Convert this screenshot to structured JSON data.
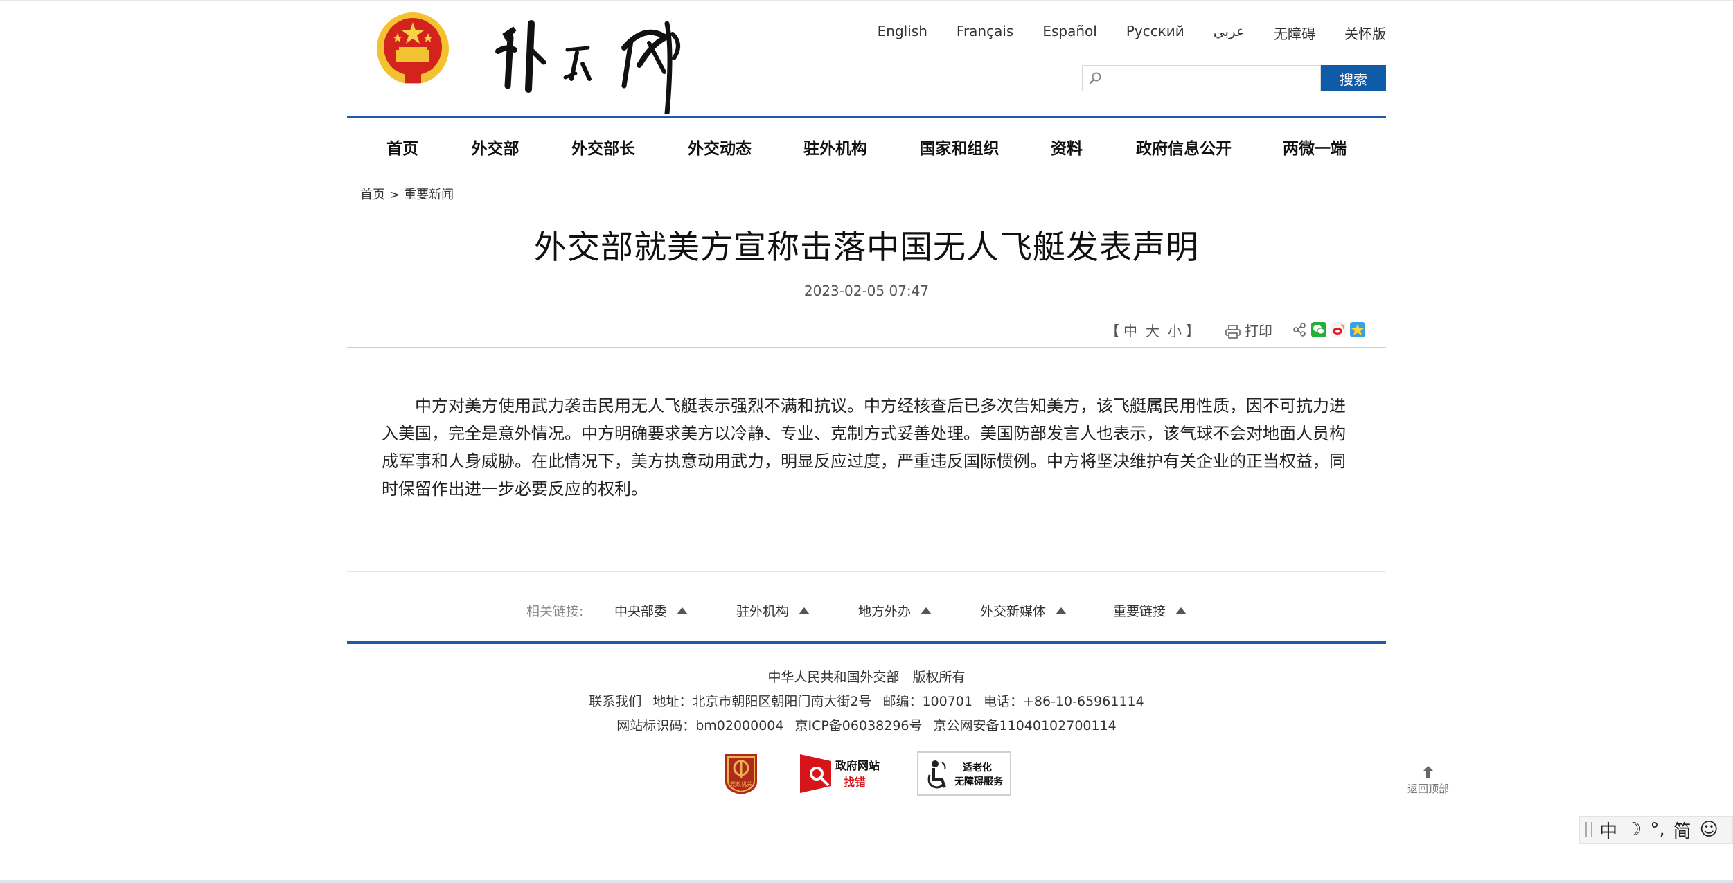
{
  "languages": [
    "English",
    "Français",
    "Español",
    "Русский",
    "عربي",
    "无障碍",
    "关怀版"
  ],
  "search": {
    "placeholder": "",
    "button_label": "搜索"
  },
  "nav": [
    "首页",
    "外交部",
    "外交部长",
    "外交动态",
    "驻外机构",
    "国家和组织",
    "资料",
    "政府信息公开",
    "两微一端"
  ],
  "breadcrumb": {
    "home": "首页",
    "sep": ">",
    "current": "重要新闻"
  },
  "article": {
    "title": "外交部就美方宣称击落中国无人飞艇发表声明",
    "date": "2023-02-05 07:47",
    "body": "中方对美方使用武力袭击民用无人飞艇表示强烈不满和抗议。中方经核查后已多次告知美方，该飞艇属民用性质，因不可抗力进入美国，完全是意外情况。中方明确要求美方以冷静、专业、克制方式妥善处理。美国防部发言人也表示，该气球不会对地面人员构成军事和人身威胁。在此情况下，美方执意动用武力，明显反应过度，严重违反国际惯例。中方将坚决维护有关企业的正当权益，同时保留作出进一步必要反应的权利。"
  },
  "tools": {
    "bracket_open": "【",
    "sizes": [
      "中",
      "大",
      "小"
    ],
    "bracket_close": "】",
    "print_label": "打印",
    "share_icons": [
      "share-icon",
      "wechat-icon",
      "weibo-icon",
      "qzone-icon"
    ]
  },
  "related": {
    "label": "相关链接:",
    "items": [
      "中央部委",
      "驻外机构",
      "地方外办",
      "外交新媒体",
      "重要链接"
    ]
  },
  "footer": {
    "line1": "中华人民共和国外交部　版权所有",
    "line2": [
      "联系我们",
      "地址：北京市朝阳区朝阳门南大街2号",
      "邮编：100701",
      "电话：+86-10-65961114"
    ],
    "line3": [
      "网站标识码：bm02000004",
      "京ICP备06038296号",
      "京公网安备11040102700114"
    ],
    "badges": {
      "party": "党政机关",
      "gov_title": "政府网站",
      "gov_sub": "找错",
      "access_title": "适老化",
      "access_sub": "无障碍服务"
    }
  },
  "backtop": "返回顶部",
  "ime": [
    "中",
    "☽",
    "°,",
    "简",
    "☺"
  ],
  "colors": {
    "accent": "#1e5aa8",
    "search_button": "#0f5ba7",
    "emblem_red": "#d3231c",
    "emblem_gold": "#f2c230"
  }
}
